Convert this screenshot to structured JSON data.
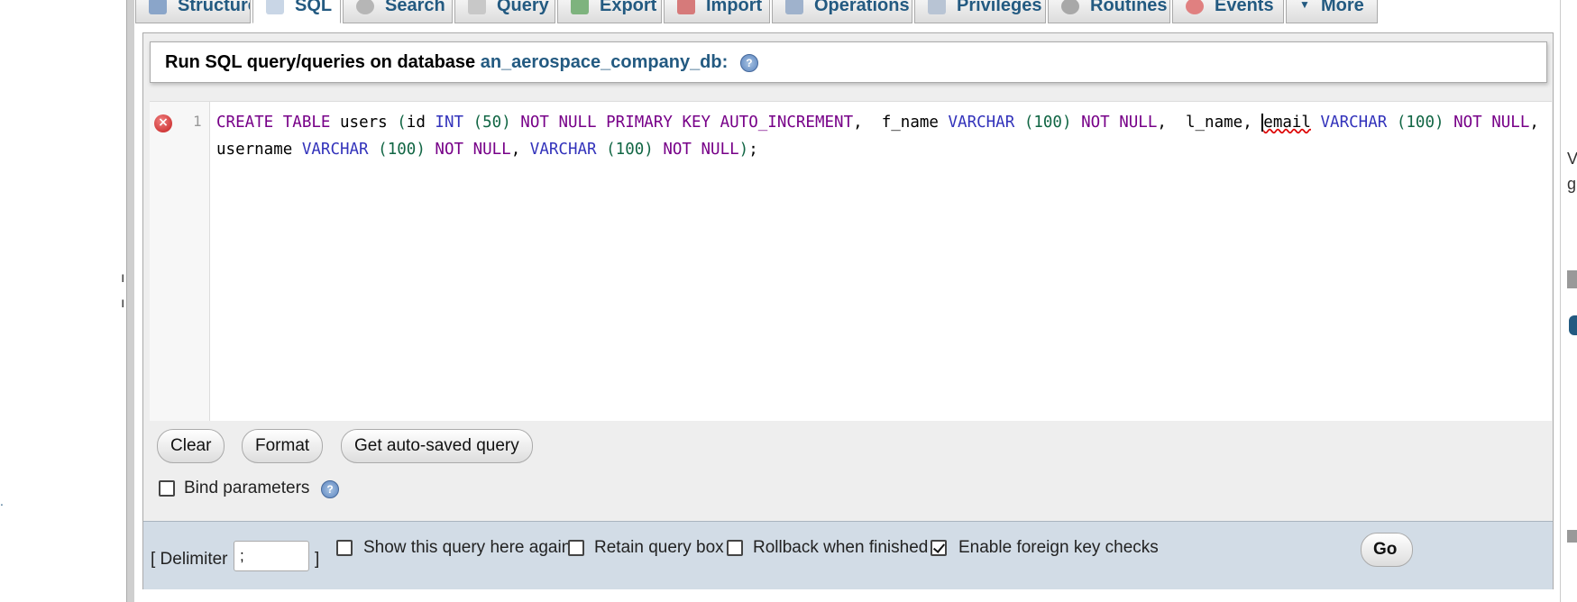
{
  "tabs": [
    {
      "label": "Structure",
      "active": false,
      "icon": "structure-icon"
    },
    {
      "label": "SQL",
      "active": true,
      "icon": "sql-icon"
    },
    {
      "label": "Search",
      "active": false,
      "icon": "search-icon"
    },
    {
      "label": "Query",
      "active": false,
      "icon": "query-icon"
    },
    {
      "label": "Export",
      "active": false,
      "icon": "export-icon"
    },
    {
      "label": "Import",
      "active": false,
      "icon": "import-icon"
    },
    {
      "label": "Operations",
      "active": false,
      "icon": "operations-icon"
    },
    {
      "label": "Privileges",
      "active": false,
      "icon": "privileges-icon"
    },
    {
      "label": "Routines",
      "active": false,
      "icon": "routines-icon"
    },
    {
      "label": "Events",
      "active": false,
      "icon": "events-icon"
    },
    {
      "label": "More",
      "active": false,
      "icon": "chevron-down-icon"
    }
  ],
  "query_panel": {
    "heading_prefix": "Run SQL query/queries on database ",
    "database": "an_aerospace_company_db",
    "heading_suffix": ":"
  },
  "editor": {
    "line_number": "1",
    "error_icon": "error-icon",
    "query": "CREATE TABLE users (id INT (50) NOT NULL PRIMARY KEY AUTO_INCREMENT,  f_name VARCHAR (100) NOT NULL,  l_name, email VARCHAR (100) NOT NULL, username VARCHAR (100) NOT NULL, VARCHAR (100) NOT NULL);"
  },
  "buttons": {
    "clear": "Clear",
    "format": "Format",
    "get_autosaved": "Get auto-saved query",
    "go": "Go"
  },
  "bind_parameters": {
    "label": "Bind parameters",
    "checked": false
  },
  "footer": {
    "delimiter_open": "[ Delimiter",
    "delimiter_value": ";",
    "delimiter_close": "]",
    "options": [
      {
        "label": "Show this query here again",
        "checked": false
      },
      {
        "label": "Retain query box",
        "checked": false
      },
      {
        "label": "Rollback when finished",
        "checked": false
      },
      {
        "label": "Enable foreign key checks",
        "checked": true
      }
    ]
  },
  "colors": {
    "link": "#235a81",
    "keyword": "#770088",
    "type": "#3333bb",
    "number": "#116644",
    "footer_bg": "#d2dce6"
  }
}
